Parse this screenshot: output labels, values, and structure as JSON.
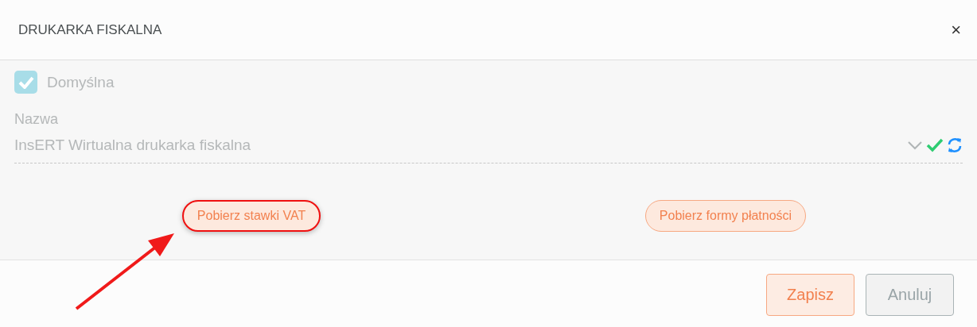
{
  "window": {
    "title": "DRUKARKA FISKALNA",
    "close": "×"
  },
  "default_checkbox": {
    "label": "Domyślna",
    "checked": true,
    "disabled": true
  },
  "name_field": {
    "label": "Nazwa",
    "value": "InsERT Wirtualna drukarka fiskalna",
    "valid": true
  },
  "actions": [
    {
      "label": "Pobierz stawki VAT",
      "highlighted": true
    },
    {
      "label": "Pobierz formy płatności",
      "highlighted": false
    }
  ],
  "footer_buttons": [
    {
      "label": "Zapisz",
      "kind": "primary"
    },
    {
      "label": "Anuluj",
      "kind": "secondary"
    }
  ],
  "annotation": {
    "arrow": true
  }
}
